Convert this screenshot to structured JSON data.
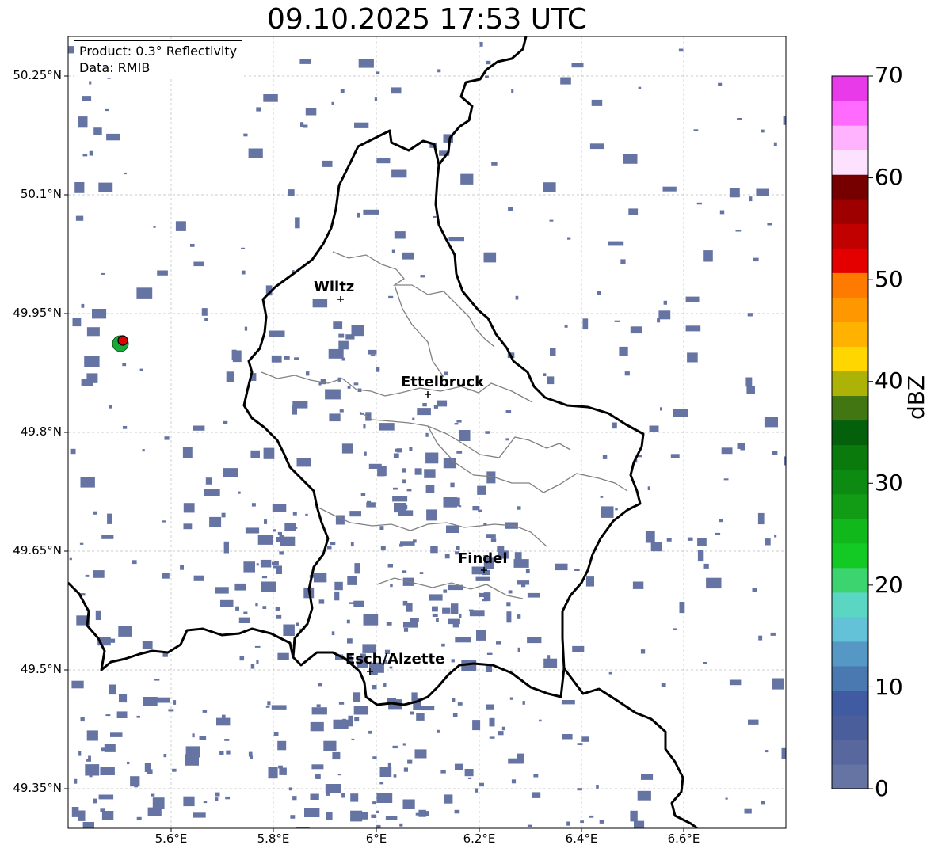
{
  "title": "09.10.2025 17:53 UTC",
  "info": {
    "product": "Product: 0.3° Reflectivity",
    "source": "Data: RMIB"
  },
  "axes": {
    "lat_ticks": [
      "50.25°N",
      "50.1°N",
      "49.95°N",
      "49.8°N",
      "49.65°N",
      "49.5°N",
      "49.35°N"
    ],
    "lon_ticks": [
      "5.6°E",
      "5.8°E",
      "6°E",
      "6.2°E",
      "6.4°E",
      "6.6°E"
    ]
  },
  "cities": [
    {
      "name": "Wiltz"
    },
    {
      "name": "Ettelbruck"
    },
    {
      "name": "Findel"
    },
    {
      "name": "Esch/Alzette"
    }
  ],
  "colorbar": {
    "label": "dBZ",
    "min": 0,
    "max": 70,
    "step": 2.5,
    "ticks": [
      "70",
      "60",
      "50",
      "40",
      "30",
      "20",
      "10",
      "0"
    ],
    "colors": [
      "#6674a4",
      "#58689e",
      "#4a5e9b",
      "#415ba2",
      "#4a78b0",
      "#5598c5",
      "#63c2d8",
      "#5bd6c3",
      "#3cd46f",
      "#13c924",
      "#10b81b",
      "#129c15",
      "#0d8a12",
      "#0a7a0d",
      "#05600b",
      "#427612",
      "#adb306",
      "#ffd600",
      "#ffb300",
      "#ff9700",
      "#ff7a00",
      "#e50000",
      "#c10000",
      "#9e0000",
      "#760000",
      "#fde2ff",
      "#ffb3ff",
      "#ff6bff",
      "#e93ae9"
    ]
  },
  "colors": {
    "echo": "#6674a4",
    "border": "#000000",
    "canton": "#808080",
    "grid": "#bbbbbb",
    "radar_site": "#e00000"
  }
}
